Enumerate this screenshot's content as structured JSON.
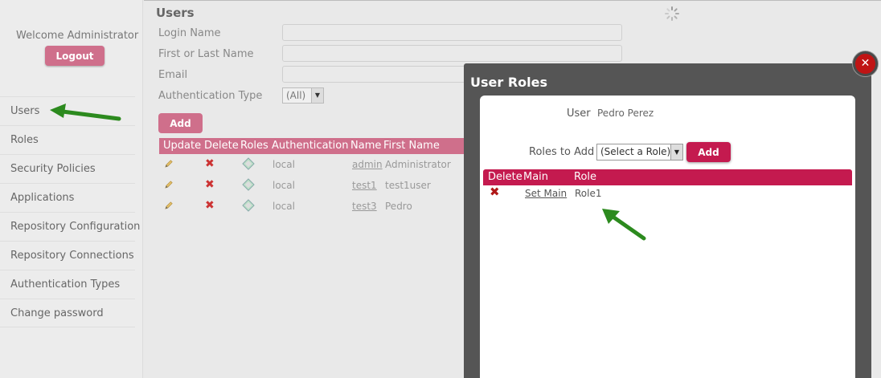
{
  "sidebar": {
    "welcome": "Welcome Administrator",
    "logout_label": "Logout",
    "items": [
      {
        "label": "Users"
      },
      {
        "label": "Roles"
      },
      {
        "label": "Security Policies"
      },
      {
        "label": "Applications"
      },
      {
        "label": "Repository Configuration"
      },
      {
        "label": "Repository Connections"
      },
      {
        "label": "Authentication Types"
      },
      {
        "label": "Change password"
      }
    ]
  },
  "users_page": {
    "title": "Users",
    "filters": {
      "login_name": {
        "label": "Login Name",
        "value": ""
      },
      "name": {
        "label": "First or Last Name",
        "value": ""
      },
      "email": {
        "label": "Email",
        "value": ""
      },
      "auth_type": {
        "label": "Authentication Type",
        "value": "(All)"
      }
    },
    "add_label": "Add",
    "table": {
      "columns": [
        "Update",
        "Delete",
        "Roles",
        "Authentication",
        "Name",
        "First Name"
      ],
      "rows": [
        {
          "auth": "local",
          "name": "admin",
          "first": "Administrator"
        },
        {
          "auth": "local",
          "name": "test1",
          "first": "test1user"
        },
        {
          "auth": "local",
          "name": "test3",
          "first": "Pedro"
        }
      ]
    }
  },
  "modal": {
    "title": "User Roles",
    "close_icon": "close-icon",
    "user_label": "User",
    "user_value": "Pedro Perez",
    "roles_to_add_label": "Roles to Add",
    "role_select_value": "(Select a Role)",
    "add_label": "Add",
    "table": {
      "columns": [
        "Delete",
        "Main",
        "Role"
      ],
      "rows": [
        {
          "main_link": "Set Main",
          "role": "Role1"
        }
      ]
    }
  },
  "colors": {
    "accent": "#c41a4f",
    "accent_dimmed": "#cf6f8b",
    "annotation_arrow": "#2c8a1e",
    "modal_frame": "#555555"
  }
}
